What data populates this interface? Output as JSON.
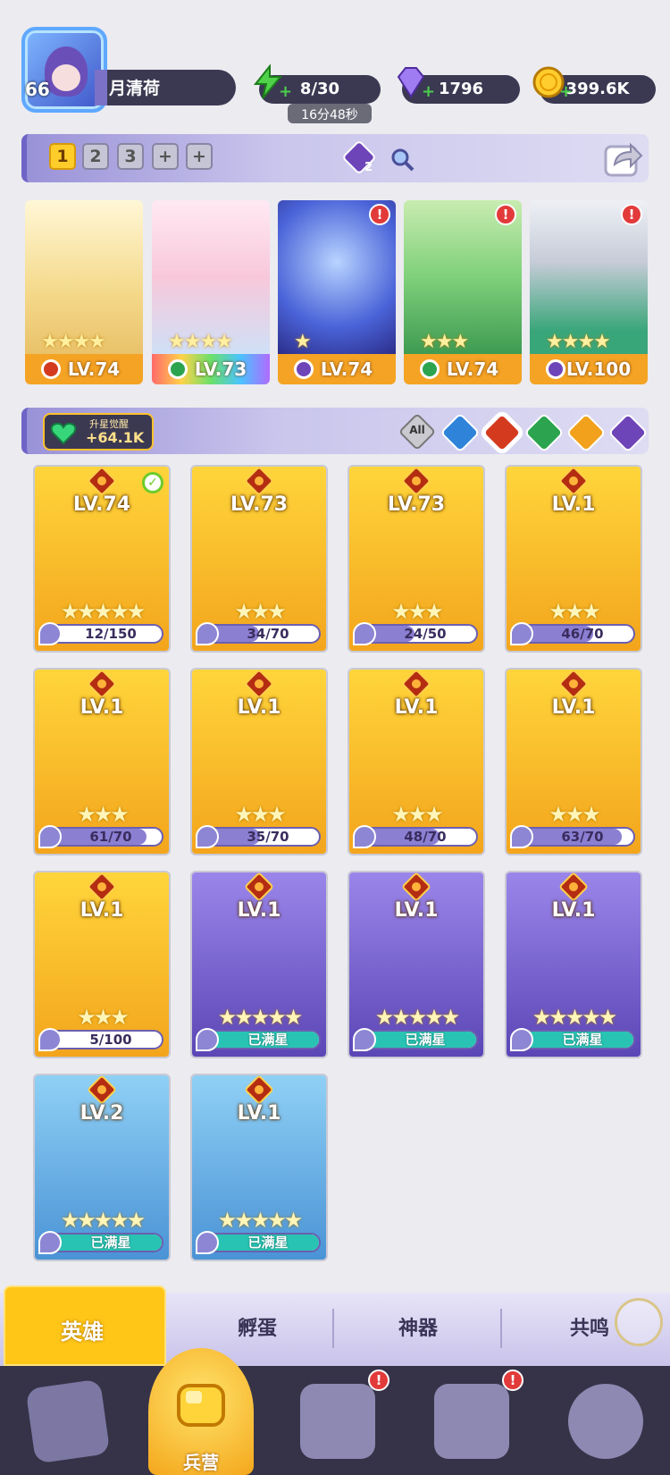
{
  "player": {
    "level": "66",
    "name": "月清荷"
  },
  "resources": {
    "energy": "8/30",
    "energy_timer": "16分48秒",
    "gems": "1796",
    "gold": "399.6K"
  },
  "team_bar": {
    "slots": [
      "1",
      "2",
      "3"
    ],
    "selected": "1",
    "add_slots": [
      "+",
      "+"
    ],
    "purple_badge_count": "2"
  },
  "team_heroes": [
    {
      "level": "LV.74",
      "element": "fire",
      "stars": "★★★★",
      "alert": ""
    },
    {
      "level": "LV.73",
      "element": "wind",
      "stars": "★★★★",
      "alert": ""
    },
    {
      "level": "LV.74",
      "element": "dark",
      "stars": "★",
      "alert": "!"
    },
    {
      "level": "LV.74",
      "element": "wind",
      "stars": "★★★",
      "alert": "!"
    },
    {
      "level": "LV.100",
      "element": "dark",
      "stars": "★★★★",
      "alert": "!"
    }
  ],
  "awaken": {
    "label": "升星觉醒",
    "value": "+64.1K"
  },
  "filters": {
    "all": "All",
    "items": [
      "water",
      "fire",
      "wind",
      "light",
      "dark"
    ],
    "selected": "fire"
  },
  "heroes": [
    {
      "level": "LV.74",
      "progress": "12/150",
      "ratio": 0.08,
      "stars": "★★★★★",
      "frame": "gold",
      "check": true
    },
    {
      "level": "LV.73",
      "progress": "34/70",
      "ratio": 0.49,
      "stars": "★★★",
      "frame": "gold"
    },
    {
      "level": "LV.73",
      "progress": "24/50",
      "ratio": 0.48,
      "stars": "★★★",
      "frame": "gold"
    },
    {
      "level": "LV.1",
      "progress": "46/70",
      "ratio": 0.66,
      "stars": "★★★",
      "frame": "gold"
    },
    {
      "level": "LV.1",
      "progress": "61/70",
      "ratio": 0.87,
      "stars": "★★★",
      "frame": "gold"
    },
    {
      "level": "LV.1",
      "progress": "35/70",
      "ratio": 0.5,
      "stars": "★★★",
      "frame": "gold"
    },
    {
      "level": "LV.1",
      "progress": "48/70",
      "ratio": 0.69,
      "stars": "★★★",
      "frame": "gold"
    },
    {
      "level": "LV.1",
      "progress": "63/70",
      "ratio": 0.9,
      "stars": "★★★",
      "frame": "gold"
    },
    {
      "level": "LV.1",
      "progress": "5/100",
      "ratio": 0.05,
      "stars": "★★★",
      "frame": "gold"
    },
    {
      "level": "LV.1",
      "progress": "已满星",
      "ratio": 1,
      "stars": "★★★★★",
      "frame": "purple",
      "full": true
    },
    {
      "level": "LV.1",
      "progress": "已满星",
      "ratio": 1,
      "stars": "★★★★★",
      "frame": "purple",
      "full": true
    },
    {
      "level": "LV.1",
      "progress": "已满星",
      "ratio": 1,
      "stars": "★★★★★",
      "frame": "purple",
      "full": true
    },
    {
      "level": "LV.2",
      "progress": "已满星",
      "ratio": 1,
      "stars": "★★★★★",
      "frame": "blue",
      "full": true
    },
    {
      "level": "LV.1",
      "progress": "已满星",
      "ratio": 1,
      "stars": "★★★★★",
      "frame": "blue",
      "full": true
    }
  ],
  "sub_tabs": [
    "英雄",
    "孵蛋",
    "神器",
    "共鸣"
  ],
  "bottom_nav": {
    "active_label": "兵营",
    "alerts": [
      "!",
      "!"
    ]
  },
  "colors": {
    "accent_gold": "#ffc618",
    "nav_bg": "#363349",
    "full_bar": "#29c3b3"
  }
}
